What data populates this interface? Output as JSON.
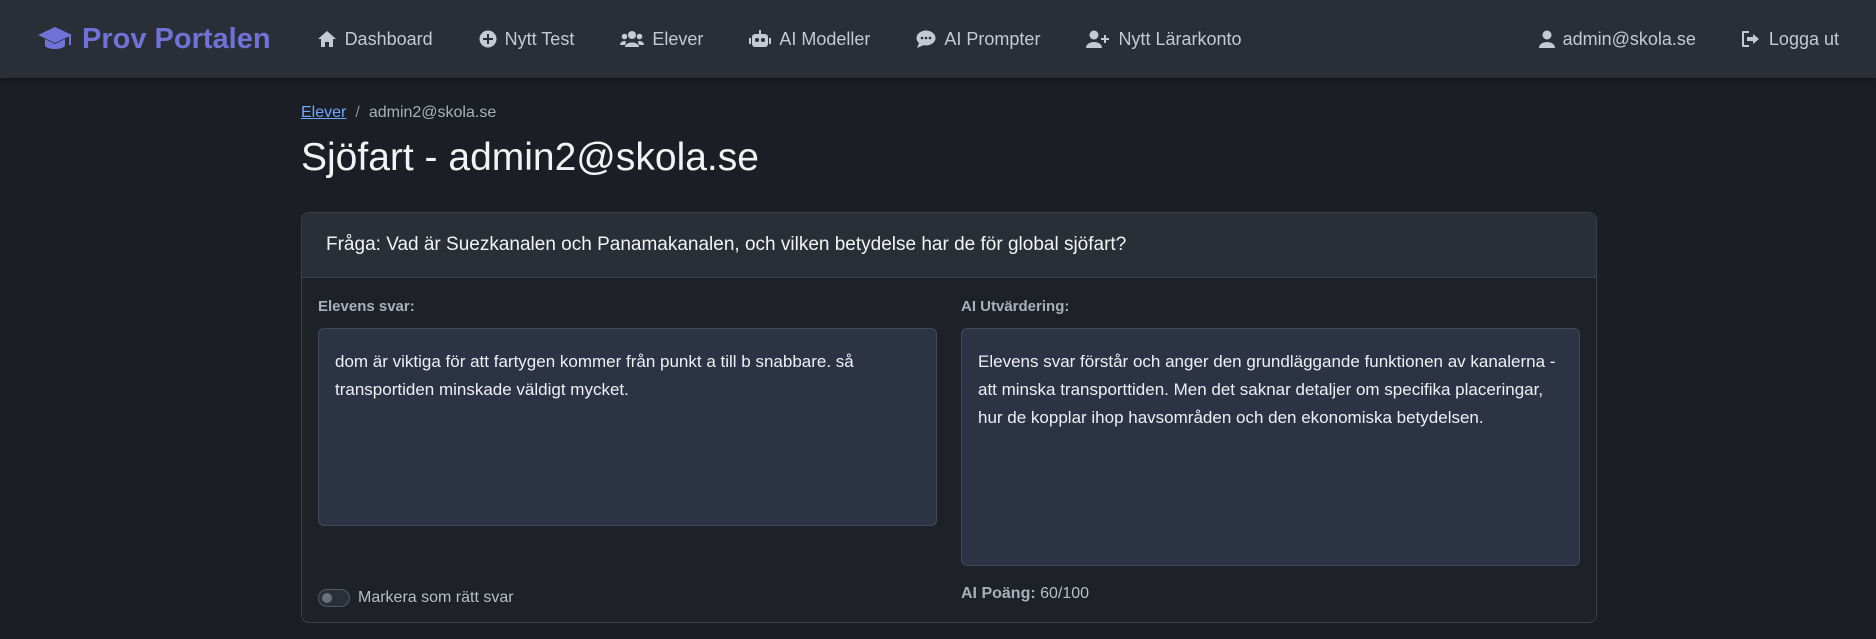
{
  "nav": {
    "brand": "Prov Portalen",
    "items": [
      {
        "label": "Dashboard",
        "icon": "home-icon"
      },
      {
        "label": "Nytt Test",
        "icon": "plus-circle-icon"
      },
      {
        "label": "Elever",
        "icon": "users-icon"
      },
      {
        "label": "AI Modeller",
        "icon": "robot-icon"
      },
      {
        "label": "AI Prompter",
        "icon": "comments-icon"
      },
      {
        "label": "Nytt Lärarkonto",
        "icon": "user-plus-icon"
      }
    ],
    "user": "admin@skola.se",
    "logout": "Logga ut"
  },
  "breadcrumb": {
    "parent": "Elever",
    "separator": "/",
    "current": "admin2@skola.se"
  },
  "page_title": "Sjöfart - admin2@skola.se",
  "question": {
    "header": "Fråga: Vad är Suezkanalen och Panamakanalen, och vilken betydelse har de för global sjöfart?"
  },
  "student": {
    "label": "Elevens svar:",
    "answer": "dom är viktiga för att fartygen kommer från punkt a till b snabbare. så transportiden minskade väldigt mycket.",
    "mark_correct_label": "Markera som rätt svar",
    "mark_correct_checked": false
  },
  "ai": {
    "label": "AI Utvärdering:",
    "evaluation": "Elevens svar förstår och anger den grundläggande funktionen av kanalerna - att minska transporttiden. Men det saknar detaljer om specifika placeringar, hur de kopplar ihop havsområden och den ekonomiska betydelsen.",
    "score_label": "AI Poäng:",
    "score_value": "60/100"
  },
  "colors": {
    "brand": "#6f72d6",
    "link": "#6ea8fe",
    "background": "#1b1e24",
    "navbar": "#2a2e37",
    "textbox": "#2b3344"
  }
}
